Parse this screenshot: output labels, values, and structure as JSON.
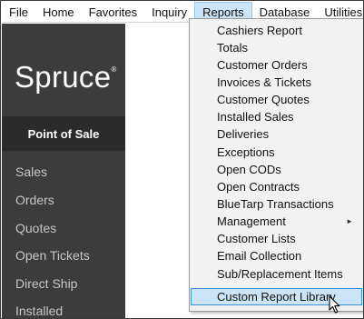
{
  "menubar": {
    "items": [
      "File",
      "Home",
      "Favorites",
      "Inquiry",
      "Reports",
      "Database",
      "Utilities"
    ],
    "active": "Reports"
  },
  "sidebar": {
    "logo": "Spruce",
    "logo_mark": "®",
    "section": "Point of Sale",
    "items": [
      "Sales",
      "Orders",
      "Quotes",
      "Open Tickets",
      "Direct Ship",
      "Installed"
    ]
  },
  "reports_menu": {
    "items": [
      "Cashiers Report",
      "Totals",
      "Customer Orders",
      "Invoices & Tickets",
      "Customer Quotes",
      "Installed Sales",
      "Deliveries",
      "Exceptions",
      "Open CODs",
      "Open Contracts",
      "BlueTarp Transactions",
      "Management",
      "Customer Lists",
      "Email Collection",
      "Sub/Replacement Items",
      "Custom Report Library"
    ],
    "submenu_arrow": "►",
    "highlighted": "Custom Report Library"
  },
  "colors": {
    "sidebar_bg": "#3c3c3c",
    "highlight_bg": "#cce4f7",
    "highlight_border": "#3c8ed8"
  }
}
